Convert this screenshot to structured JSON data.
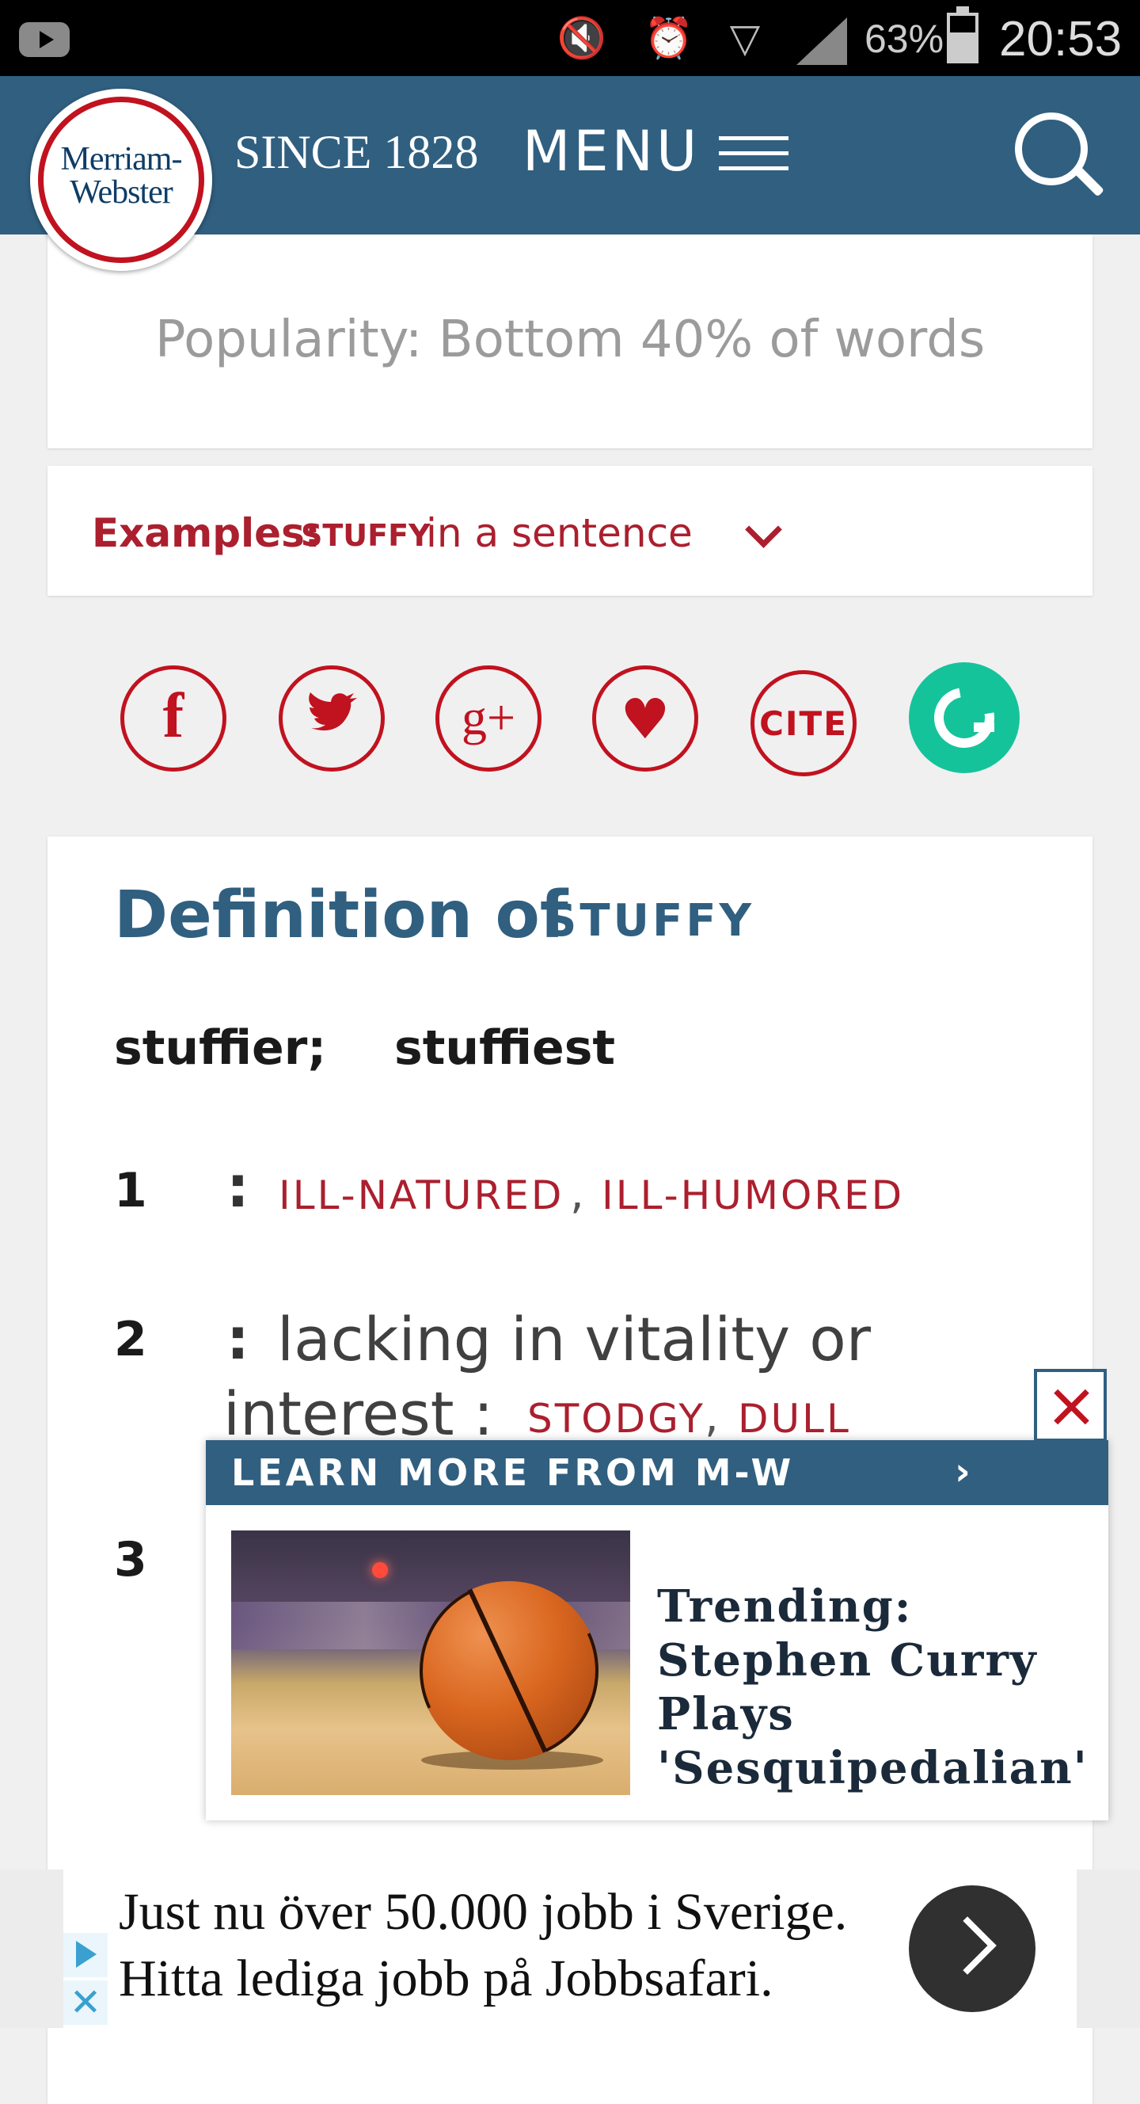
{
  "status_bar": {
    "battery": "63%",
    "time": "20:53"
  },
  "header": {
    "logo_line1": "Merriam-",
    "logo_line2": "Webster",
    "since": "SINCE 1828",
    "menu_label": "MENU"
  },
  "popularity": {
    "text": "Popularity: Bottom 40% of words"
  },
  "examples": {
    "label": "Examples:",
    "word": "STUFFY",
    "rest": "in a sentence"
  },
  "social": {
    "facebook": "f",
    "google_plus": "g+",
    "cite": "CITE"
  },
  "definition": {
    "title": "Definition of",
    "word": "STUFFY",
    "inflection_1": "stuffier;",
    "inflection_2": "stuffiest",
    "senses": [
      {
        "num": "1",
        "xref_1": "ILL-NATURED",
        "xref_2": "ILL-HUMORED"
      },
      {
        "num": "2",
        "text_1": "lacking in vitality or",
        "text_2": "interest :",
        "xref_1": "STODGY",
        "xref_2": "DULL"
      },
      {
        "num": "3"
      }
    ]
  },
  "learn_more": {
    "bar_label": "LEARN MORE FROM M-W",
    "title": "Trending: Stephen Curry Plays 'Sesquipedalian'"
  },
  "ad": {
    "line_1": "Just nu över 50.000 jobb i Sverige.",
    "line_2": "Hitta lediga jobb på Jobbsafari."
  },
  "colors": {
    "header_blue": "#305f80",
    "mw_red": "#c1121f",
    "grammarly_green": "#15c39a"
  }
}
